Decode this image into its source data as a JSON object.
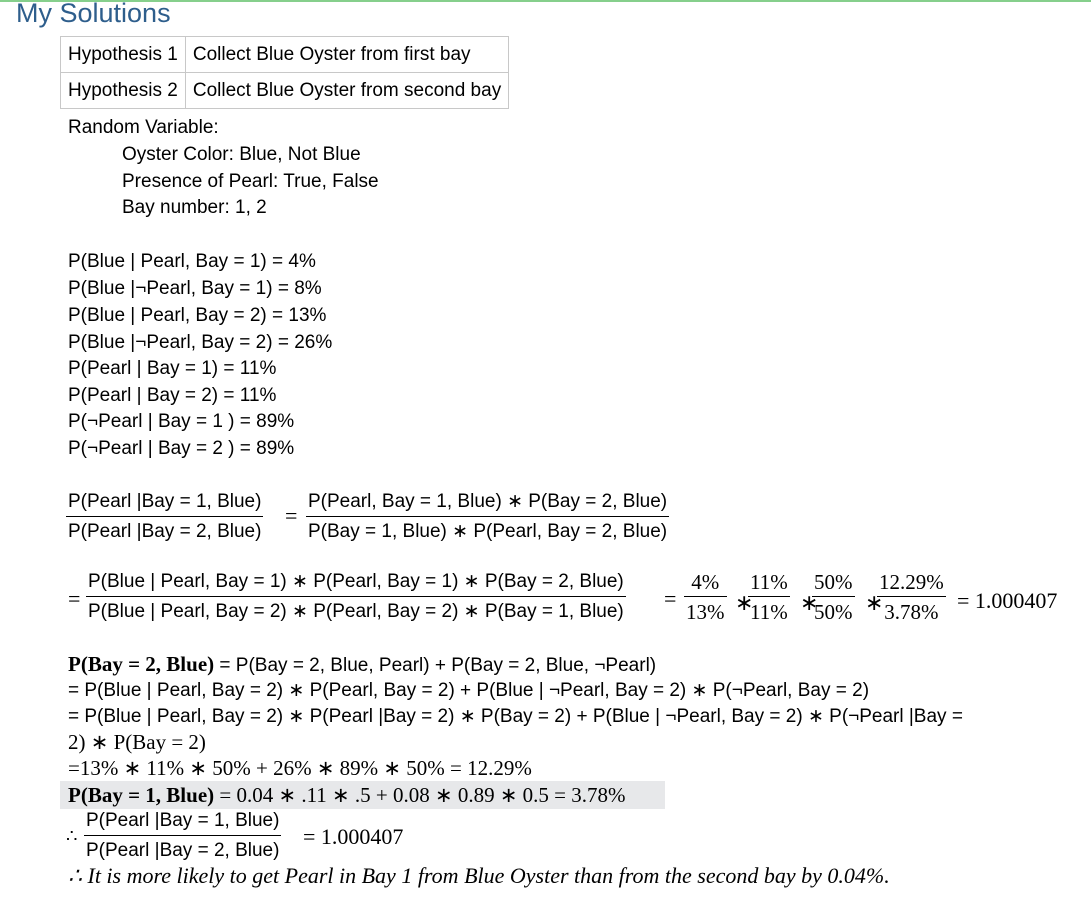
{
  "title": "My Solutions",
  "hypotheses": [
    {
      "label": "Hypothesis 1",
      "text": "Collect Blue Oyster from first bay"
    },
    {
      "label": "Hypothesis 2",
      "text": "Collect Blue Oyster from second bay"
    }
  ],
  "random_variable": {
    "heading": "Random Variable:",
    "items": [
      "Oyster Color: Blue, Not Blue",
      "Presence of Pearl: True, False",
      "Bay number: 1, 2"
    ]
  },
  "probabilities": [
    "P(Blue |  Pearl, Bay = 1) = 4%",
    "P(Blue |¬Pearl, Bay = 1) = 8%",
    "P(Blue |  Pearl, Bay = 2) = 13%",
    "P(Blue |¬Pearl, Bay = 2) = 26%",
    "P(Pearl | Bay = 1) = 11%",
    "P(Pearl | Bay = 2) = 11%",
    "P(¬Pearl | Bay = 1 ) = 89%",
    "P(¬Pearl | Bay = 2 ) = 89%"
  ],
  "eq1": {
    "lhs_num": "P(Pearl |Bay  =  1, Blue)",
    "lhs_den": "P(Pearl |Bay  = 2, Blue)",
    "eq": "=",
    "rhs_num": "P(Pearl, Bay  =  1, Blue) ∗ P(Bay  = 2, Blue)",
    "rhs_den": "P(Bay = 1, Blue) ∗ P(Pearl, Bay  = 2, Blue)"
  },
  "eq2": {
    "eq": "=",
    "num": "P(Blue |  Pearl, Bay  =  1)  ∗ P(Pearl, Bay  =  1) ∗ P(Bay  = 2, Blue)",
    "den": "P(Blue |  Pearl, Bay  = 2)  ∗ P(Pearl, Bay  = 2) ∗ P(Bay  = 1, Blue)",
    "eq_b": "=",
    "fractions": [
      {
        "num": "4%",
        "den": "13%"
      },
      {
        "num": "11%",
        "den": "11%"
      },
      {
        "num": "50%",
        "den": "50%"
      },
      {
        "num": "12.29%",
        "den": "3.78%"
      }
    ],
    "times": "∗",
    "result": "= 1.000407"
  },
  "bay2": {
    "lhs": "P(Bay  = 2, Blue)",
    "line1_rest": " = P(Bay  = 2, Blue, Pearl) + P(Bay  = 2, Blue, ¬Pearl)",
    "line2": "= P(Blue |  Pearl, Bay  =  2) ∗ P(Pearl, Bay = 2) +  P(Blue | ¬Pearl, Bay  =  2) ∗ P(¬Pearl, Bay = 2)",
    "line3": "= P(Blue |  Pearl, Bay  =  2) ∗ P(Pearl |Bay = 2) ∗ P(Bay = 2) +  P(Blue | ¬Pearl, Bay  =  2) ∗ P(¬Pearl |Bay =",
    "line4": "2) ∗ P(Bay = 2)",
    "line5": "=13% ∗ 11% ∗ 50% + 26% ∗ 89% ∗ 50% = 12.29%"
  },
  "bay1": {
    "lhs": "P(Bay  = 1, Blue)",
    "rest": " = 0.04 ∗ .11 ∗ .5 + 0.08 ∗ 0.89 ∗ 0.5 = 3.78%"
  },
  "conclusion": {
    "therefore": "∴",
    "num": "P(Pearl |Bay  =  1, Blue)",
    "den": "P(Pearl |Bay  = 2, Blue)",
    "result": "= 1.000407",
    "statement": "∴ It is more likely to get Pearl in Bay 1 from Blue Oyster than from the second bay by 0.04%."
  }
}
